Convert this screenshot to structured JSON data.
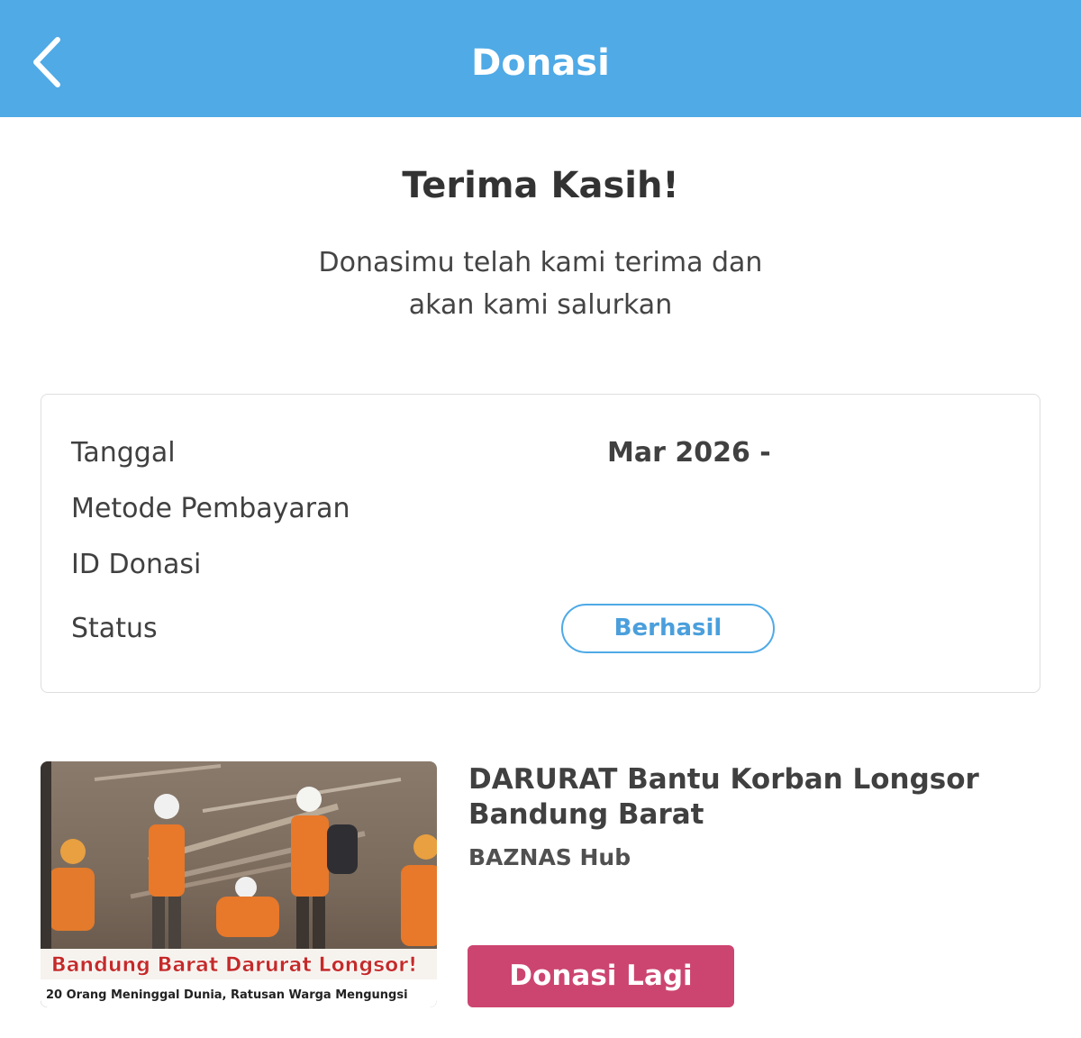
{
  "header": {
    "title": "Donasi",
    "back_icon": "chevron-left-icon",
    "color": "#4faae6"
  },
  "thanks": {
    "title": "Terima Kasih!",
    "message_line1": "Donasimu telah kami terima dan",
    "message_line2": "akan kami salurkan"
  },
  "details": {
    "date_label": "Tanggal",
    "date_value": "Mar 2026 -",
    "payment_label": "Metode Pembayaran",
    "id_label": "ID Donasi",
    "status_label": "Status",
    "status_value": "Berhasil",
    "status_color": "#4faae6"
  },
  "campaign": {
    "image_headline": "Bandung Barat Darurat Longsor!",
    "image_subline": "20 Orang Meninggal Dunia, Ratusan Warga Mengungsi",
    "title": "DARURAT Bantu Korban Longsor Bandung Barat",
    "organizer": "BAZNAS Hub",
    "button_label": "Donasi Lagi",
    "button_color": "#cc4570"
  }
}
